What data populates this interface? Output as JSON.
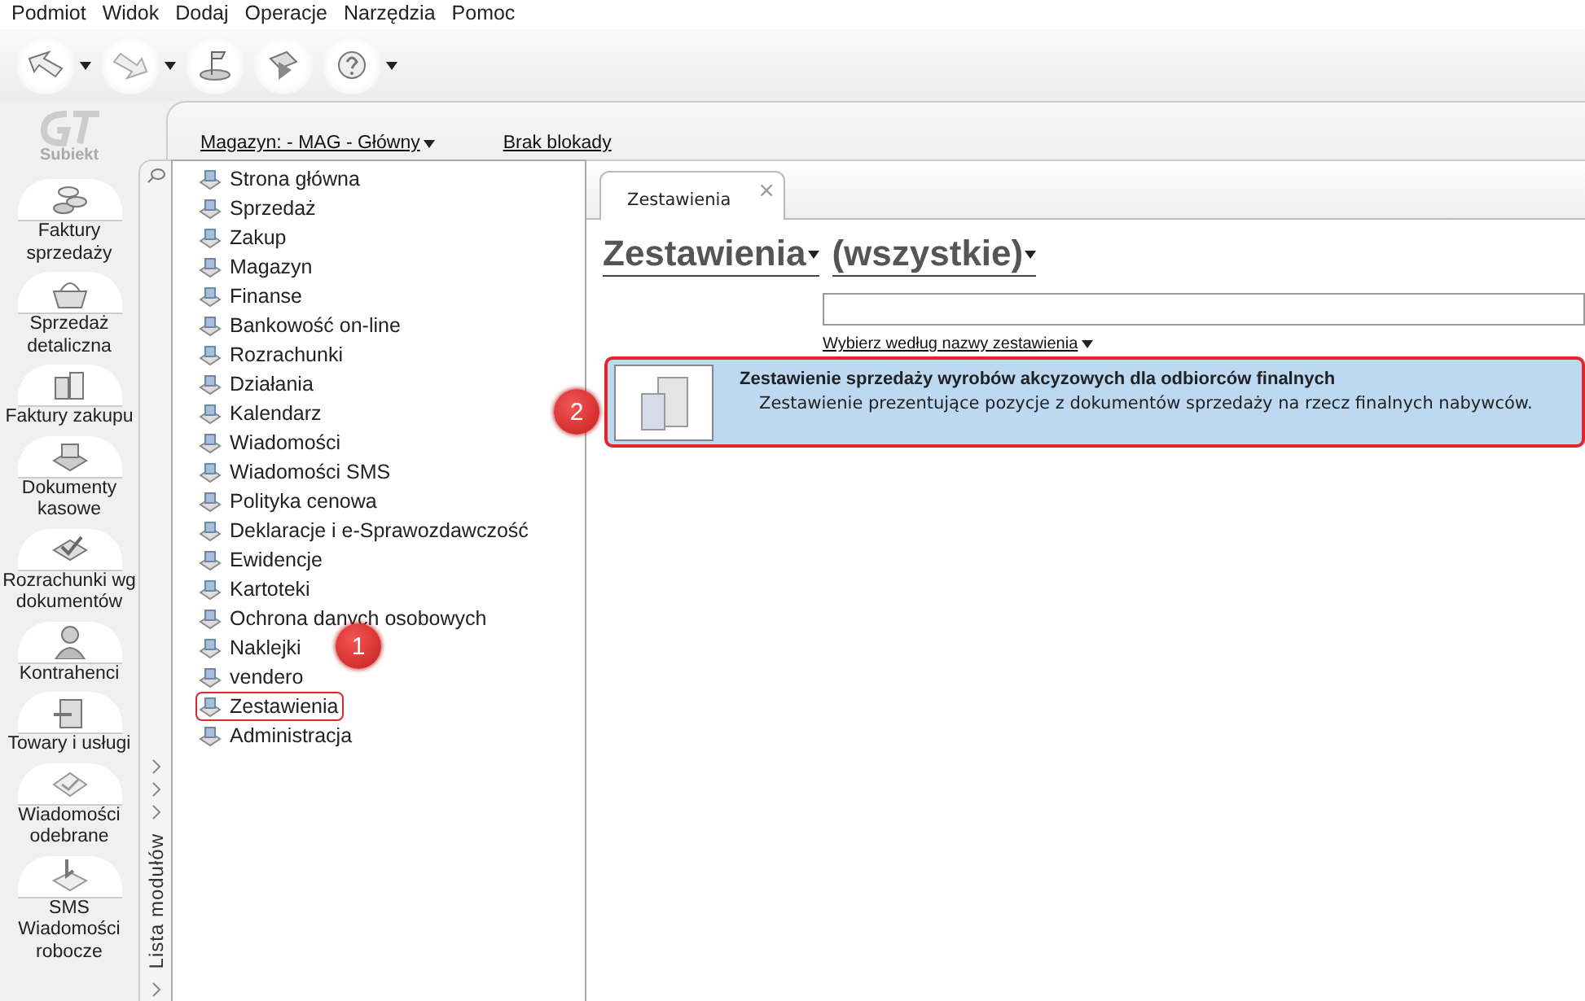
{
  "menu": [
    "Podmiot",
    "Widok",
    "Dodaj",
    "Operacje",
    "Narzędzia",
    "Pomoc"
  ],
  "toolbar": [
    {
      "kind": "back",
      "dropdown": true
    },
    {
      "kind": "forward",
      "dropdown": true
    },
    {
      "kind": "flag",
      "dropdown": false
    },
    {
      "kind": "play",
      "dropdown": false
    },
    {
      "kind": "help",
      "dropdown": true
    }
  ],
  "logo": {
    "text": "Subiekt"
  },
  "sidebar": {
    "items": [
      {
        "label": "Faktury sprzedaży",
        "kind": "coins"
      },
      {
        "label": "Sprzedaż detaliczna",
        "kind": "basket"
      },
      {
        "label": "Faktury zakupu",
        "kind": "boxes"
      },
      {
        "label": "Dokumenty kasowe",
        "kind": "register"
      },
      {
        "label": "Rozrachunki wg dokumentów",
        "kind": "check"
      },
      {
        "label": "Kontrahenci",
        "kind": "person"
      },
      {
        "label": "Towary i usługi",
        "kind": "box"
      },
      {
        "label": "Wiadomości odebrane",
        "kind": "mail"
      },
      {
        "label": "SMS Wiadomości robocze",
        "kind": "sms"
      }
    ]
  },
  "header": {
    "warehouse": "Magazyn: - MAG - Główny",
    "lock": "Brak blokady"
  },
  "modules": {
    "strip_label": "Lista modułów",
    "items": [
      {
        "label": "Strona główna",
        "selected": false
      },
      {
        "label": "Sprzedaż",
        "selected": false
      },
      {
        "label": "Zakup",
        "selected": false
      },
      {
        "label": "Magazyn",
        "selected": false
      },
      {
        "label": "Finanse",
        "selected": false
      },
      {
        "label": "Bankowość on-line",
        "selected": false
      },
      {
        "label": "Rozrachunki",
        "selected": false
      },
      {
        "label": "Działania",
        "selected": false
      },
      {
        "label": "Kalendarz",
        "selected": false
      },
      {
        "label": "Wiadomości",
        "selected": false
      },
      {
        "label": "Wiadomości SMS",
        "selected": false
      },
      {
        "label": "Polityka cenowa",
        "selected": false
      },
      {
        "label": "Deklaracje i e-Sprawozdawczość",
        "selected": false
      },
      {
        "label": "Ewidencje",
        "selected": false
      },
      {
        "label": "Kartoteki",
        "selected": false
      },
      {
        "label": "Ochrona danych osobowych",
        "selected": false
      },
      {
        "label": "Naklejki",
        "selected": false
      },
      {
        "label": "vendero",
        "selected": false
      },
      {
        "label": "Zestawienia",
        "selected": true
      },
      {
        "label": "Administracja",
        "selected": false
      }
    ]
  },
  "tab": {
    "label": "Zestawienia",
    "close": "×"
  },
  "filters": {
    "category": "Zestawienia",
    "group": "(wszystkie)"
  },
  "search": {
    "hint": "Wybierz według nazwy zestawienia"
  },
  "reports": [
    {
      "title": "Zestawienie sprzedaży wyrobów akcyzowych dla odbiorców finalnych",
      "description": "Zestawienie prezentujące pozycje z dokumentów sprzedaży na rzecz finalnych nabywców.",
      "selected": true
    }
  ],
  "callouts": [
    "1",
    "2"
  ]
}
